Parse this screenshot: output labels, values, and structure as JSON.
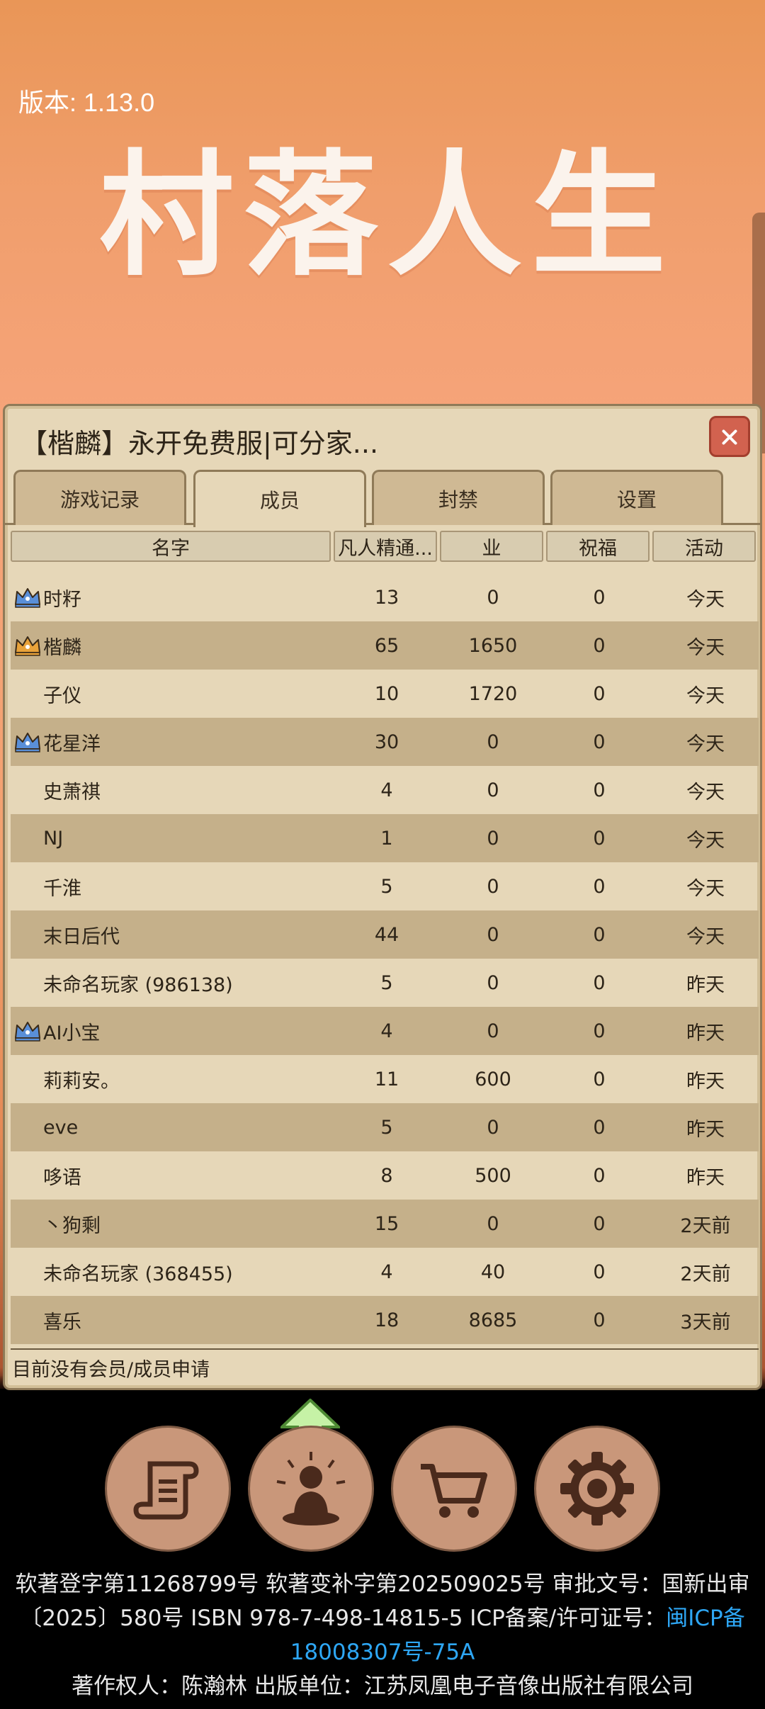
{
  "version": "版本: 1.13.0",
  "logo": [
    "村",
    "落",
    "人",
    "生"
  ],
  "panel": {
    "title": "【楷麟】永开免费服|可分家...",
    "tabs": [
      "游戏记录",
      "成员",
      "封禁",
      "设置"
    ],
    "active_tab": "成员",
    "columns": [
      "名字",
      "凡人精通...",
      "业",
      "祝福",
      "活动"
    ],
    "rows": [
      {
        "crown": "blue",
        "name": "时籽",
        "mastery": "13",
        "karma": "0",
        "blessing": "0",
        "activity": "今天"
      },
      {
        "crown": "gold",
        "name": "楷麟",
        "mastery": "65",
        "karma": "1650",
        "blessing": "0",
        "activity": "今天"
      },
      {
        "crown": "",
        "name": "子仪",
        "mastery": "10",
        "karma": "1720",
        "blessing": "0",
        "activity": "今天"
      },
      {
        "crown": "blue",
        "name": "花星洋",
        "mastery": "30",
        "karma": "0",
        "blessing": "0",
        "activity": "今天"
      },
      {
        "crown": "",
        "name": "史萧祺",
        "mastery": "4",
        "karma": "0",
        "blessing": "0",
        "activity": "今天"
      },
      {
        "crown": "",
        "name": "NJ",
        "mastery": "1",
        "karma": "0",
        "blessing": "0",
        "activity": "今天"
      },
      {
        "crown": "",
        "name": "千淮",
        "mastery": "5",
        "karma": "0",
        "blessing": "0",
        "activity": "今天"
      },
      {
        "crown": "",
        "name": "末日后代",
        "mastery": "44",
        "karma": "0",
        "blessing": "0",
        "activity": "今天"
      },
      {
        "crown": "",
        "name": "未命名玩家 (986138)",
        "mastery": "5",
        "karma": "0",
        "blessing": "0",
        "activity": "昨天"
      },
      {
        "crown": "blue",
        "name": "AI小宝",
        "mastery": "4",
        "karma": "0",
        "blessing": "0",
        "activity": "昨天"
      },
      {
        "crown": "",
        "name": "莉莉安。",
        "mastery": "11",
        "karma": "600",
        "blessing": "0",
        "activity": "昨天"
      },
      {
        "crown": "",
        "name": "eve",
        "mastery": "5",
        "karma": "0",
        "blessing": "0",
        "activity": "昨天"
      },
      {
        "crown": "",
        "name": "哆语",
        "mastery": "8",
        "karma": "500",
        "blessing": "0",
        "activity": "昨天"
      },
      {
        "crown": "",
        "name": "丶狗剩",
        "mastery": "15",
        "karma": "0",
        "blessing": "0",
        "activity": "2天前"
      },
      {
        "crown": "",
        "name": "未命名玩家 (368455)",
        "mastery": "4",
        "karma": "40",
        "blessing": "0",
        "activity": "2天前"
      },
      {
        "crown": "",
        "name": "喜乐",
        "mastery": "18",
        "karma": "8685",
        "blessing": "0",
        "activity": "3天前"
      }
    ],
    "footer": "目前没有会员/成员申请"
  },
  "bottom_buttons": [
    "scroll-icon",
    "meditation-icon",
    "cart-icon",
    "gear-icon"
  ],
  "legal": {
    "line1": "软著登字第11268799号 软著变补字第202509025号 审批文号：国新出审",
    "line2_prefix": "〔2025〕580号 ISBN 978-7-498-14815-5 ICP备案/许可证号：",
    "line2_link": "闽ICP备",
    "line3_link": "18008307号-75A",
    "line4": "著作权人：陈瀚林 出版单位：江苏凤凰电子音像出版社有限公司"
  },
  "colors": {
    "crown_blue": "#5a8fd8",
    "crown_gold": "#e8a23a",
    "link": "#2ea7f5",
    "close": "#d2624f"
  }
}
